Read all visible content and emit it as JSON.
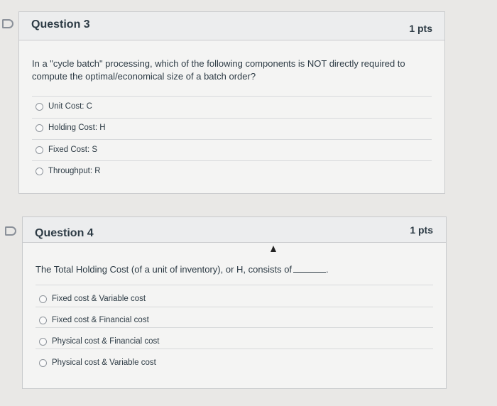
{
  "questions": [
    {
      "title": "Question 3",
      "points": "1 pts",
      "text": "In a \"cycle batch\" processing, which of the following components is NOT directly required to compute the optimal/economical size of a batch order?",
      "options": [
        "Unit Cost: C",
        "Holding Cost: H",
        "Fixed Cost: S",
        "Throughput: R"
      ]
    },
    {
      "title": "Question 4",
      "points": "1 pts",
      "text": "The Total Holding Cost (of a unit of inventory), or H, consists of",
      "text_suffix": ".",
      "options": [
        "Fixed cost & Variable cost",
        "Fixed cost & Financial cost",
        "Physical cost & Financial cost",
        "Physical cost & Variable cost"
      ]
    }
  ]
}
